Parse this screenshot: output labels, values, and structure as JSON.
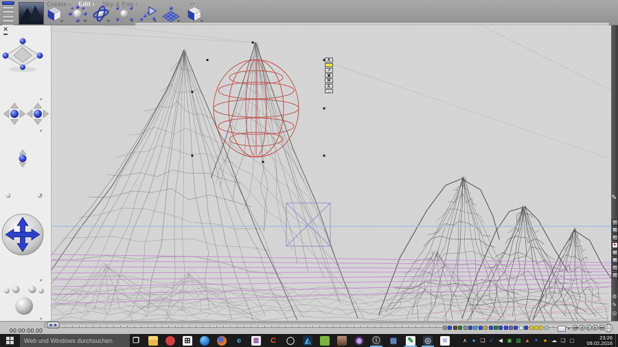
{
  "menu": {
    "items": [
      {
        "label": "Create ›",
        "name": "menu-create"
      },
      {
        "label": "Edit ›",
        "name": "menu-edit",
        "active": true
      },
      {
        "label": "Sky & Fog ›",
        "name": "menu-sky-fog"
      }
    ],
    "dots": "‥"
  },
  "toolbar": {
    "tools": [
      "create-cube",
      "resize-tool",
      "rotate-tool",
      "reposition-tool",
      "align-tool",
      "terrain-grid",
      "texture-cube"
    ]
  },
  "object_badges": [
    {
      "glyph": "A",
      "name": "attributes-badge"
    },
    {
      "glyph": "",
      "name": "solo-badge",
      "bg": "#f2e03c"
    },
    {
      "glyph": "↗",
      "name": "link-badge"
    },
    {
      "glyph": "✱",
      "name": "gear-badge"
    },
    {
      "glyph": "M",
      "name": "material-badge"
    },
    {
      "glyph": "E",
      "name": "edit-badge"
    },
    {
      "glyph": "↓",
      "name": "drop-badge"
    }
  ],
  "timeline": {
    "time": "00:00:00.00"
  },
  "transport": [
    {
      "glyph": "◀◀",
      "name": "rewind-button"
    },
    {
      "glyph": "◀",
      "name": "step-back-button"
    },
    {
      "glyph": "▶",
      "name": "play-button",
      "fg": "#1c7a1c"
    },
    {
      "glyph": "▶",
      "name": "step-forward-button"
    },
    {
      "glyph": "▶▶",
      "name": "fast-forward-button"
    }
  ],
  "selection_palette": [
    {
      "bg": "#9098a0"
    },
    {
      "bg": "#2f4fc0"
    },
    {
      "bg": "#6b4a2e"
    },
    {
      "bg": "#2e7a3a"
    },
    {
      "bg": "#8a8f96"
    },
    {
      "bg": "#2f4fc0"
    },
    {
      "bg": "#4a9ad0"
    },
    {
      "bg": "#2f4fc0"
    },
    {
      "bg": "#caa24a"
    },
    {
      "bg": "#2f4fc0"
    },
    {
      "bg": "#2e7a3a"
    },
    {
      "bg": "#2f4fc0"
    },
    {
      "bg": "#2f4fc0"
    },
    {
      "bg": "#7a5ac0"
    },
    {
      "bg": "#2f4fc0"
    },
    {
      "bg": "#e0e4ea"
    },
    {
      "bg": "#2f4fc0"
    },
    {
      "bg": "#e0c838"
    },
    {
      "bg": "#e0c838"
    },
    {
      "bg": "#e0c838"
    },
    {
      "bg": "#aac4de"
    }
  ],
  "right_strip": {
    "buttons": [
      {
        "glyph": "▭"
      },
      {
        "glyph": "▤"
      },
      {
        "glyph": "▸"
      },
      {
        "glyph": "■",
        "fg": "#cc1111",
        "bg": "#e8e8e8"
      },
      {
        "glyph": "▬"
      },
      {
        "glyph": "▣"
      },
      {
        "glyph": "≡"
      },
      {
        "glyph": "❏"
      }
    ],
    "lower_glyphs": [
      {
        "glyph": "⚙",
        "name": "gear-icon"
      },
      {
        "glyph": "✎",
        "name": "pen-icon"
      },
      {
        "glyph": "◎",
        "name": "target-icon"
      }
    ]
  },
  "taskbar": {
    "search_placeholder": "Web und Windows durchsuchen",
    "clock_time": "23:26",
    "clock_date": "09.02.2016",
    "apps": [
      {
        "name": "task-view-icon",
        "glyph": "❐",
        "fg": "#e6e6e6"
      },
      {
        "name": "file-explorer-icon",
        "glyph": "",
        "bg": "linear-gradient(#f5d978 40%, #e8b64c 40%)"
      },
      {
        "name": "red-app-icon",
        "glyph": "",
        "bg": "radial-gradient(circle,#d84040 55%,#a81c1c)",
        "round": true
      },
      {
        "name": "store-icon",
        "glyph": "⊞",
        "fg": "#222222",
        "bg": "#f2f2f2"
      },
      {
        "name": "blue-swirl-app-icon",
        "glyph": "",
        "bg": "radial-gradient(circle at 35% 30%,#7ec8f0,#1a6fd4 70%)",
        "round": true
      },
      {
        "name": "firefox-icon",
        "glyph": "",
        "bg": "radial-gradient(circle at 38% 35%,#4a6ad8 18%,#e8731a 55%,#f0a23a)",
        "round": true
      },
      {
        "name": "edge-icon",
        "glyph": "e",
        "fg": "#3ba9e8"
      },
      {
        "name": "document-app-icon",
        "glyph": "≣",
        "fg": "#7a4a9a",
        "bg": "#f0f0f0"
      },
      {
        "name": "orange-c-app-icon",
        "glyph": "C",
        "fg": "#e85a20"
      },
      {
        "name": "ring-app-icon",
        "glyph": "◯",
        "fg": "#cdd4dc"
      },
      {
        "name": "photos-app-icon",
        "glyph": "◭",
        "fg": "#55aade",
        "bg": "#14304c"
      },
      {
        "name": "android-app-icon",
        "glyph": "",
        "bg": "#7cb342"
      },
      {
        "name": "person-app-icon",
        "glyph": "",
        "bg": "linear-gradient(#c09078,#5a4030)"
      },
      {
        "name": "camera-app-icon",
        "glyph": "◉",
        "fg": "#c8a8e8",
        "bg": "#3a2355",
        "round": true
      },
      {
        "name": "info-app-icon",
        "glyph": "ⓘ",
        "fg": "#b8bcc2",
        "bg": "#2b2b2b",
        "active": true
      },
      {
        "name": "image-app-icon",
        "glyph": "▦",
        "fg": "#6a8ac8",
        "bg": "#1a1a28"
      },
      {
        "name": "quill-app-icon",
        "glyph": "✎",
        "fg": "#2e8b3a",
        "bg": "#f2f2f2",
        "active": true
      },
      {
        "name": "disc-app-icon",
        "glyph": "◎",
        "fg": "#b8c8d8",
        "bg": "#34343f",
        "active": true
      },
      {
        "name": "notepad-app-icon",
        "glyph": "≡",
        "fg": "#4a6ac8",
        "bg": "#f5f5f5"
      }
    ],
    "tray": [
      {
        "name": "tray-expand-icon",
        "glyph": "∧",
        "fg": "#e0e0e0"
      },
      {
        "name": "tray-blue-circle-icon",
        "glyph": "●",
        "fg": "#4a9ae8"
      },
      {
        "name": "tray-display-icon",
        "glyph": "❏",
        "fg": "#d0d0d0"
      },
      {
        "name": "tray-check-icon",
        "glyph": "✓",
        "fg": "#3a7ae8"
      },
      {
        "name": "tray-volume-icon",
        "glyph": "◀",
        "fg": "#e0e0e0"
      },
      {
        "name": "tray-green-box-icon",
        "glyph": "▣",
        "fg": "#4ab84a"
      },
      {
        "name": "tray-green-image-icon",
        "glyph": "▩",
        "fg": "#3a9a3a"
      },
      {
        "name": "tray-vlc-icon",
        "glyph": "▲",
        "fg": "#e8761a"
      },
      {
        "name": "tray-blue-star-icon",
        "glyph": "✦",
        "fg": "#3a6ae8"
      },
      {
        "name": "tray-orange-dot-icon",
        "glyph": "●",
        "fg": "#e8a02a"
      },
      {
        "name": "tray-cloud-icon",
        "glyph": "☁",
        "fg": "#d8d8d8"
      },
      {
        "name": "tray-monitors-icon",
        "glyph": "❏",
        "fg": "#d0d0d0"
      },
      {
        "name": "tray-tablet-icon",
        "glyph": "▢",
        "fg": "#c8c8c8"
      }
    ]
  },
  "colors": {
    "accent_blue": "#2c3db0",
    "selection_red": "#c0473e",
    "horizon_blue": "#9fc0e0",
    "plane_magenta": "#c77fd4",
    "camera_blue": "#8a90c8",
    "taskbar_bg": "#1b1b1b",
    "viewport_bg": "#d5d5d6"
  }
}
